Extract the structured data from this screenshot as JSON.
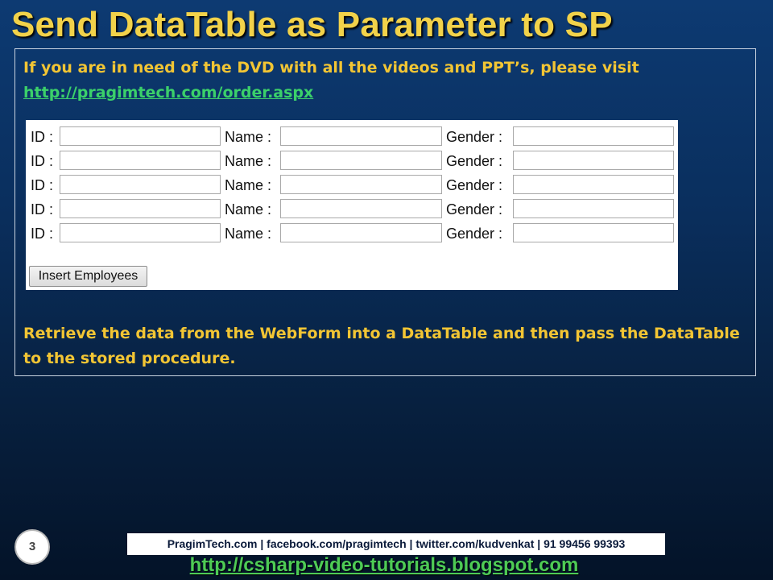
{
  "slide": {
    "title": "Send DataTable as Parameter to SP",
    "intro_text": "If you are in need of the DVD with all the videos and PPT’s, please visit",
    "intro_link": "http://pragimtech.com/order.aspx",
    "retrieve_text": "Retrieve the data from the WebForm into a DataTable and then pass the DataTable to the stored procedure.",
    "slide_number": "3",
    "footer_contacts": "PragimTech.com | facebook.com/pragimtech | twitter.com/kudvenkat | 91 99456 99393",
    "footer_link": "http://csharp-video-tutorials.blogspot.com"
  },
  "form": {
    "id_label": "ID :",
    "name_label": "Name :",
    "gender_label": "Gender :",
    "rows": [
      {
        "id": "",
        "name": "",
        "gender": ""
      },
      {
        "id": "",
        "name": "",
        "gender": ""
      },
      {
        "id": "",
        "name": "",
        "gender": ""
      },
      {
        "id": "",
        "name": "",
        "gender": ""
      },
      {
        "id": "",
        "name": "",
        "gender": ""
      }
    ],
    "insert_button": "Insert Employees"
  }
}
